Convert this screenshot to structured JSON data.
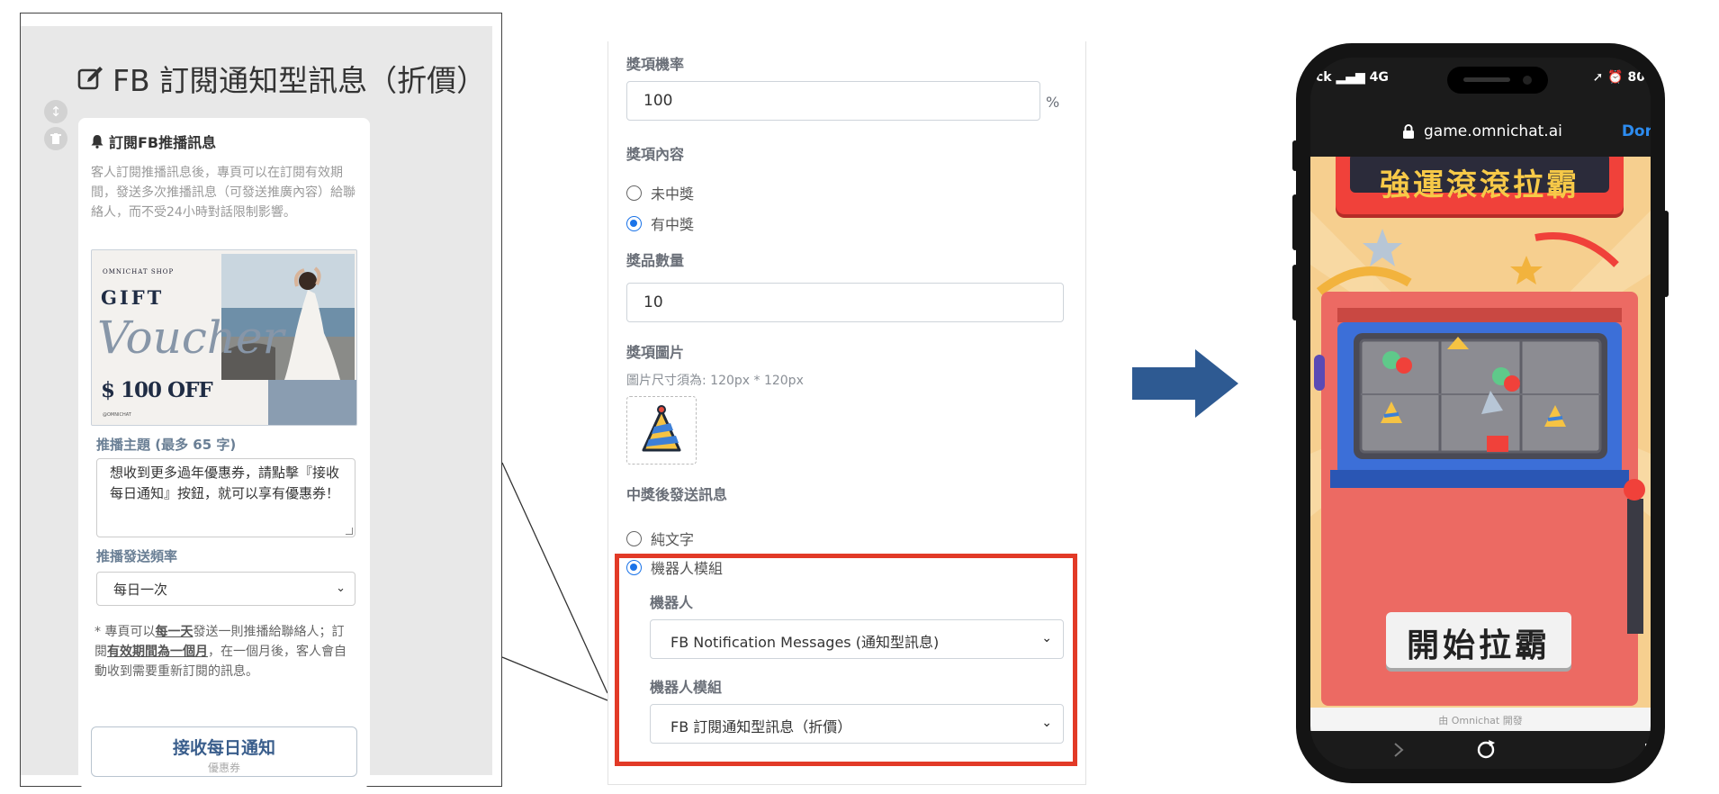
{
  "left_panel": {
    "title": "FB 訂閱通知型訊息（折價）",
    "card": {
      "heading": "訂閱FB推播訊息",
      "description": "客人訂閱推播訊息後，專頁可以在訂閱有效期間，發送多次推播訊息（可發送推廣內容）給聯絡人，而不受24小時對話限制影響。",
      "voucher": {
        "shop": "OMNICHAT SHOP",
        "gift": "GIFT",
        "script": "Voucher",
        "off": "$ 100 OFF",
        "sub": "@OMNICHAT"
      },
      "topic_label": "推播主題 (最多 65 字)",
      "topic_value": "想收到更多過年優惠券，請點擊『接收每日通知』按鈕，就可以享有優惠券！",
      "frequency_label": "推播發送頻率",
      "frequency_value": "每日一次",
      "note_prefix": "* 專頁可以",
      "note_em1": "每一天",
      "note_mid1": "發送一則推播給聯絡人；訂閱",
      "note_em2": "有效期間為一個月",
      "note_tail": "，在一個月後，客人會自動收到需要重新訂閱的訊息。",
      "button_label": "接收每日通知",
      "button_sub": "優惠券"
    }
  },
  "form": {
    "prize_rate_label": "獎項機率",
    "prize_rate_value": "100",
    "percent": "%",
    "prize_content_label": "獎項內容",
    "option_no_prize": "未中獎",
    "option_prize": "有中獎",
    "quantity_label": "獎品數量",
    "quantity_value": "10",
    "image_label": "獎項圖片",
    "image_hint": "圖片尺寸須為: 120px * 120px",
    "after_win_label": "中獎後發送訊息",
    "option_text": "純文字",
    "option_bot": "機器人模組",
    "bot_label": "機器人",
    "bot_value": "FB Notification Messages (通知型訊息)",
    "module_label": "機器人模組",
    "module_value": "FB 訂閱通知型訊息（折價）"
  },
  "phone": {
    "carrier": "ck",
    "network": "4G",
    "battery": "80",
    "url": "game.omnichat.ai",
    "done": "Dor",
    "game_title": "強運滾滾拉霸",
    "start_button": "開始拉霸",
    "footer": "由 Omnichat 開發"
  },
  "colors": {
    "highlight_box": "#e23a27",
    "arrow": "#2e5a92",
    "radio_selected": "#1a73e8"
  }
}
